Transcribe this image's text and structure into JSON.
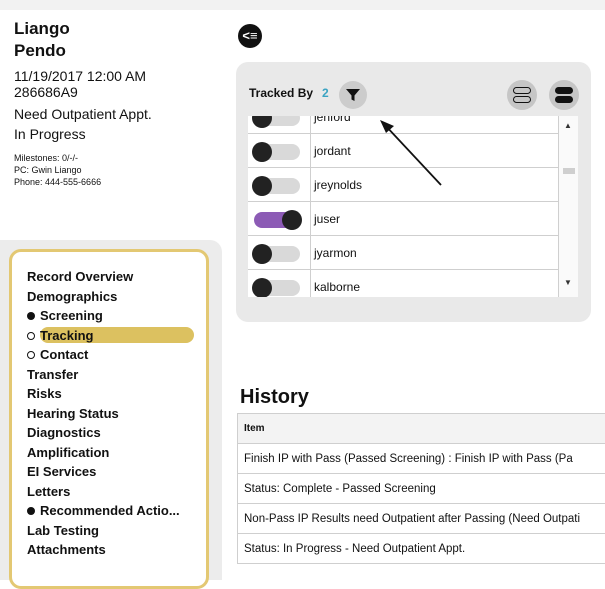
{
  "patient": {
    "first_name": "Liango",
    "last_name": "Pendo",
    "date": "11/19/2017 12:00 AM",
    "id": "286686A9",
    "status_line1": "Need Outpatient Appt.",
    "status_line2": "In Progress",
    "milestones": "Milestones: 0/-/-",
    "pc": "PC: Gwin Liango",
    "phone": "Phone: 444-555-6666"
  },
  "nav": {
    "items": [
      {
        "label": "Record Overview",
        "bullet": "none"
      },
      {
        "label": "Demographics",
        "bullet": "none"
      },
      {
        "label": "Screening",
        "bullet": "filled"
      },
      {
        "label": "Tracking",
        "bullet": "hollow",
        "active": true
      },
      {
        "label": "Contact",
        "bullet": "hollow"
      },
      {
        "label": "Transfer",
        "bullet": "none"
      },
      {
        "label": "Risks",
        "bullet": "none"
      },
      {
        "label": "Hearing Status",
        "bullet": "none"
      },
      {
        "label": "Diagnostics",
        "bullet": "none"
      },
      {
        "label": "Amplification",
        "bullet": "none"
      },
      {
        "label": "EI Services",
        "bullet": "none"
      },
      {
        "label": "Letters",
        "bullet": "none"
      },
      {
        "label": "Recommended Actio...",
        "bullet": "filled"
      },
      {
        "label": "Lab Testing",
        "bullet": "none"
      },
      {
        "label": "Attachments",
        "bullet": "none"
      }
    ]
  },
  "collapse_icon": "collapse-left-icon",
  "tracked": {
    "title": "Tracked By",
    "count": "2",
    "filter_icon": "filter-icon",
    "users": [
      {
        "name": "jenford",
        "on": false
      },
      {
        "name": "jordant",
        "on": false
      },
      {
        "name": "jreynolds",
        "on": false
      },
      {
        "name": "juser",
        "on": true
      },
      {
        "name": "jyarmon",
        "on": false
      },
      {
        "name": "kalborne",
        "on": false
      }
    ]
  },
  "history": {
    "title": "History",
    "column": "Item",
    "rows": [
      "Finish IP with Pass (Passed Screening) : Finish IP with Pass (Pa",
      "Status: Complete - Passed Screening",
      "Non-Pass IP Results need Outpatient after Passing (Need Outpati",
      "Status: In Progress - Need Outpatient Appt."
    ]
  },
  "colors": {
    "accent_yellow": "#d9bd57",
    "toggle_on": "#8c5bb5",
    "count_blue": "#3aa3c2"
  }
}
